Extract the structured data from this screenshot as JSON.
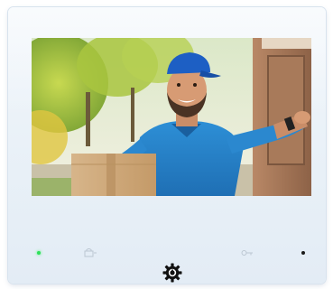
{
  "device": {
    "screen_subject": "delivery-man-with-parcel",
    "icons": {
      "left_touch": "door-lock-icon",
      "right_touch": "key-icon",
      "center": "settings-gear-icon"
    },
    "status_led_color": "#2ee05a"
  }
}
